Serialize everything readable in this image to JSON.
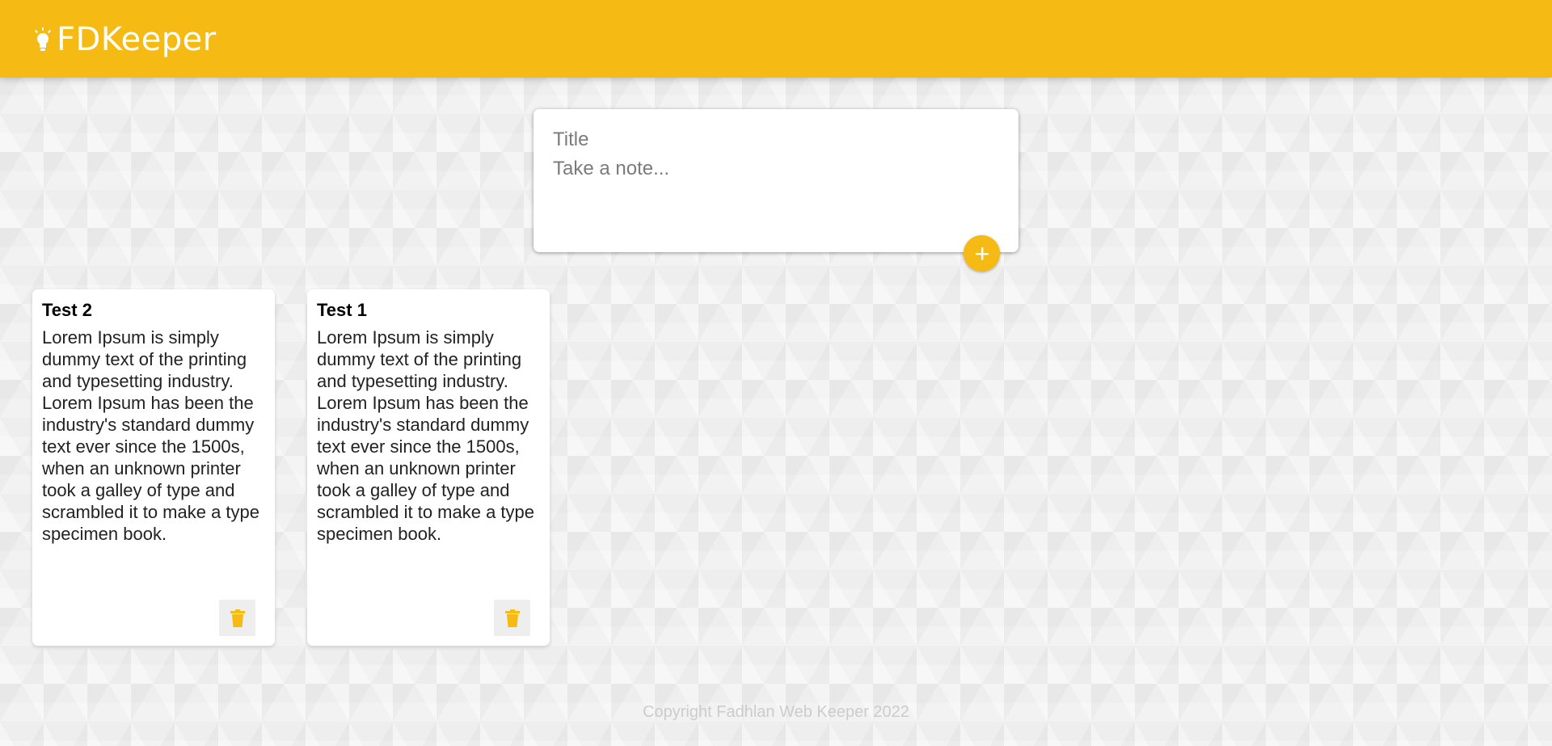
{
  "app": {
    "title": "FDKeeper",
    "logo_icon": "lightbulb-icon",
    "accent_color": "#f5ba13"
  },
  "compose": {
    "title_placeholder": "Title",
    "content_placeholder": "Take a note...",
    "add_button_icon": "plus-icon"
  },
  "notes": [
    {
      "title": "Test 2",
      "content": "Lorem Ipsum is simply dummy text of the printing and typesetting industry. Lorem Ipsum has been the industry's standard dummy text ever since the 1500s, when an unknown printer took a galley of type and scrambled it to make a type specimen book.",
      "delete_icon": "trash-icon"
    },
    {
      "title": "Test 1",
      "content": "Lorem Ipsum is simply dummy text of the printing and typesetting industry. Lorem Ipsum has been the industry's standard dummy text ever since the 1500s, when an unknown printer took a galley of type and scrambled it to make a type specimen book.",
      "delete_icon": "trash-icon"
    }
  ],
  "footer": {
    "text": "Copyright Fadhlan Web Keeper 2022"
  }
}
